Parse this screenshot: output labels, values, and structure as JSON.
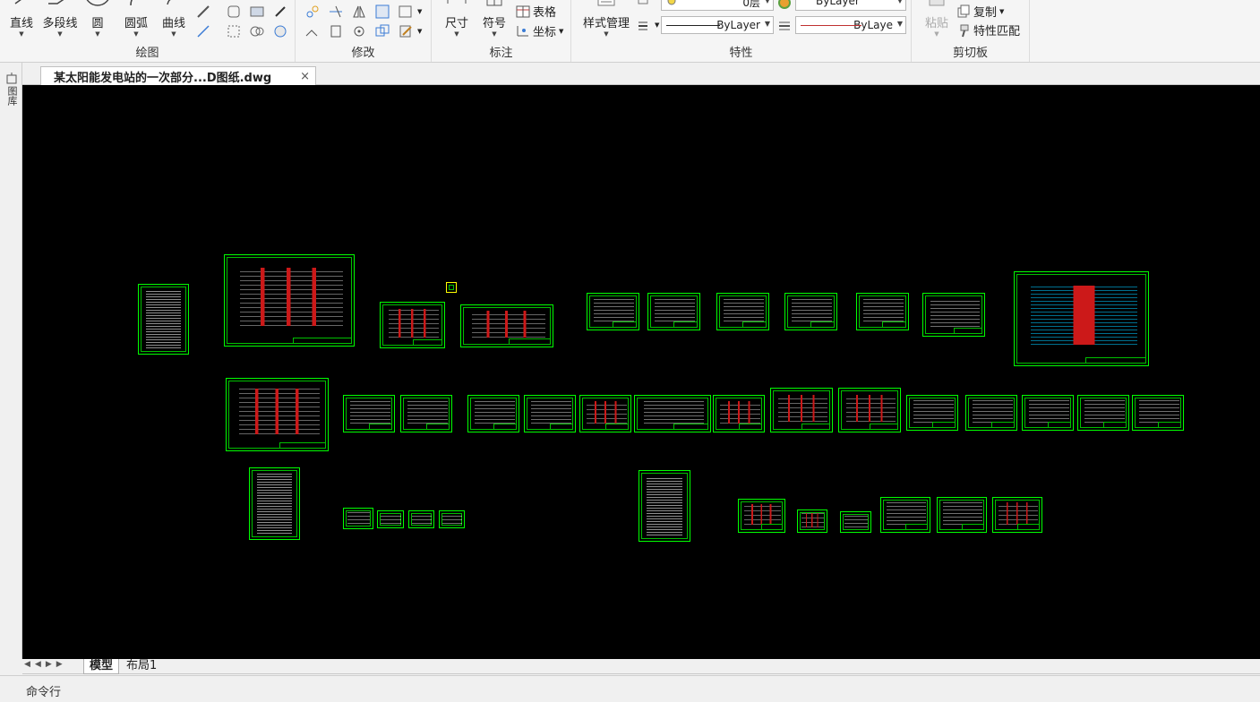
{
  "ribbon": {
    "draw_group": {
      "title": "绘图",
      "line": "直线",
      "polyline": "多段线",
      "circle": "圆",
      "arc": "圆弧",
      "curve": "曲线"
    },
    "modify_group": {
      "title": "修改"
    },
    "annotate_group": {
      "title": "标注",
      "dimension": "尺寸",
      "symbol": "符号",
      "table": "表格",
      "coordinate": "坐标"
    },
    "properties_group": {
      "title": "特性",
      "style_manager": "样式管理",
      "layer_value": "0层",
      "color_value": "ByLayer",
      "linetype_value": "ByLayer",
      "lineweight_value": "ByLaye"
    },
    "clipboard_group": {
      "title": "剪切板",
      "paste": "粘贴",
      "copy": "复制",
      "match_properties": "特性匹配"
    }
  },
  "left_strip": {
    "label": "图库"
  },
  "document_tab": {
    "title": "某太阳能发电站的一次部分...D图纸.dwg",
    "close": "×"
  },
  "layout_tabs": {
    "model": "模型",
    "layout1": "布局1"
  },
  "command_line": {
    "label": "命令行"
  },
  "colors": {
    "canvas": "#000000",
    "sheet_border": "#00ff00",
    "accent_red": "#ff2020",
    "accent_cyan": "#00c8ff"
  }
}
